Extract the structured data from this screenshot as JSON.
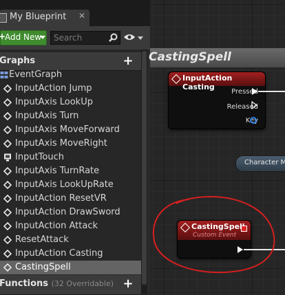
{
  "tab": {
    "label": "My Blueprint"
  },
  "toolbar": {
    "add_new_label": "Add New",
    "search_placeholder": "Search"
  },
  "graphs_section": {
    "title": "Graphs",
    "items": [
      {
        "label": "EventGraph",
        "icon": "event-graph-icon"
      },
      {
        "label": "InputAction Jump",
        "icon": "event-diamond-icon"
      },
      {
        "label": "InputAxis LookUp",
        "icon": "event-diamond-icon"
      },
      {
        "label": "InputAxis Turn",
        "icon": "event-diamond-icon"
      },
      {
        "label": "InputAxis MoveForward",
        "icon": "event-diamond-icon"
      },
      {
        "label": "InputAxis MoveRight",
        "icon": "event-diamond-icon"
      },
      {
        "label": "InputTouch",
        "icon": "touch-icon"
      },
      {
        "label": "InputAxis TurnRate",
        "icon": "event-diamond-icon"
      },
      {
        "label": "InputAxis LookUpRate",
        "icon": "event-diamond-icon"
      },
      {
        "label": "InputAction ResetVR",
        "icon": "event-diamond-icon"
      },
      {
        "label": "InputAction DrawSword",
        "icon": "event-diamond-icon"
      },
      {
        "label": "InputAction Attack",
        "icon": "event-diamond-icon"
      },
      {
        "label": "ResetAttack",
        "icon": "event-diamond-icon"
      },
      {
        "label": "InputAction Casting",
        "icon": "event-diamond-icon"
      },
      {
        "label": "CastingSpell",
        "icon": "event-diamond-icon",
        "selected": true
      }
    ]
  },
  "functions_section": {
    "title": "Functions",
    "subtitle": "(32 Overridable)"
  },
  "graph": {
    "title": "CastingSpell",
    "input_node": {
      "title": "InputAction Casting",
      "pins": [
        "Pressed",
        "Released",
        "Key"
      ]
    },
    "call_node": {
      "title": "Character Mov"
    },
    "custom_event_node": {
      "title": "CastingSpell",
      "subtitle": "Custom Event"
    }
  },
  "colors": {
    "accent_green": "#3f8c2e",
    "event_red": "#a32020",
    "annotation_red": "#d81f1f",
    "selected_row": "#646464"
  }
}
